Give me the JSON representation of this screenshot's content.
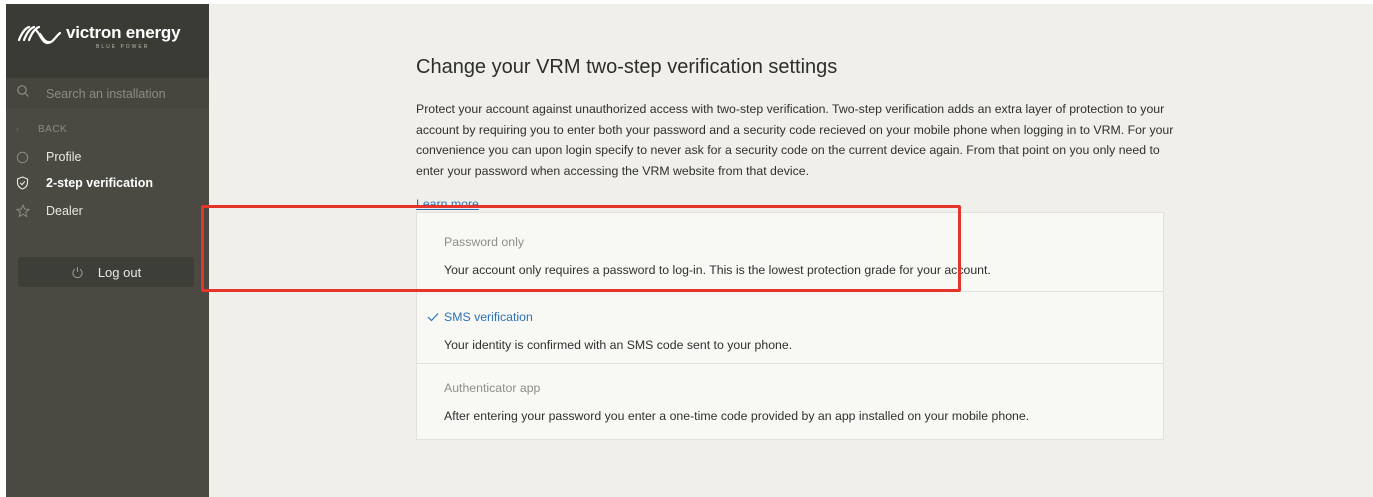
{
  "brand": {
    "name": "victron energy",
    "tagline": "BLUE POWER"
  },
  "sidebar": {
    "search_placeholder": "Search an installation",
    "back_label": "BACK",
    "items": [
      {
        "label": "Profile",
        "icon": "circle-icon"
      },
      {
        "label": "2-step verification",
        "icon": "shield-icon",
        "active": true
      },
      {
        "label": "Dealer",
        "icon": "star-icon"
      }
    ],
    "logout_label": "Log out"
  },
  "main": {
    "title": "Change your VRM two-step verification settings",
    "description": "Protect your account against unauthorized access with two-step verification. Two-step verification adds an extra layer of protection to your account by requiring you to enter both your password and a security code recieved on your mobile phone when logging in to VRM. For your convenience you can upon login specify to never ask for a security code on the current device again. From that point on you only need to enter your password when accessing the VRM website from that device.",
    "learn_more": "Learn more",
    "options": [
      {
        "title": "Password only",
        "text": "Your account only requires a password to log-in. This is the lowest protection grade for your account.",
        "selected": false
      },
      {
        "title": "SMS verification",
        "text": "Your identity is confirmed with an SMS code sent to your phone.",
        "selected": true
      },
      {
        "title": "Authenticator app",
        "text": "After entering your password you enter a one-time code provided by an app installed on your mobile phone.",
        "selected": false
      }
    ]
  },
  "colors": {
    "sidebar_bg": "#4a4a43",
    "content_bg": "#f0efea",
    "link": "#2c72b8",
    "highlight": "#e5342a"
  }
}
